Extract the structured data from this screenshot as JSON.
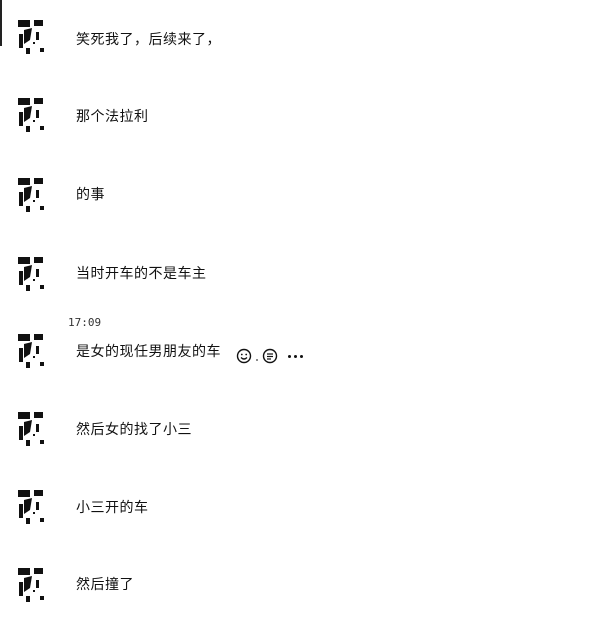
{
  "chat": {
    "messages": [
      {
        "text": "笑死我了，后续来了，",
        "avatar": "panda-avatar"
      },
      {
        "text": "那个法拉利",
        "avatar": "panda-avatar"
      },
      {
        "text": "的事",
        "avatar": "panda-avatar"
      },
      {
        "text": "当时开车的不是车主",
        "avatar": "panda-avatar"
      },
      {
        "text": "是女的现任男朋友的车",
        "avatar": "panda-avatar",
        "time": "17:09"
      },
      {
        "text": "然后女的找了小三",
        "avatar": "panda-avatar"
      },
      {
        "text": "小三开的车",
        "avatar": "panda-avatar"
      },
      {
        "text": "然后撞了",
        "avatar": "panda-avatar"
      }
    ],
    "hover_actions": [
      "smile-icon",
      "quote-icon",
      "more-icon"
    ]
  }
}
